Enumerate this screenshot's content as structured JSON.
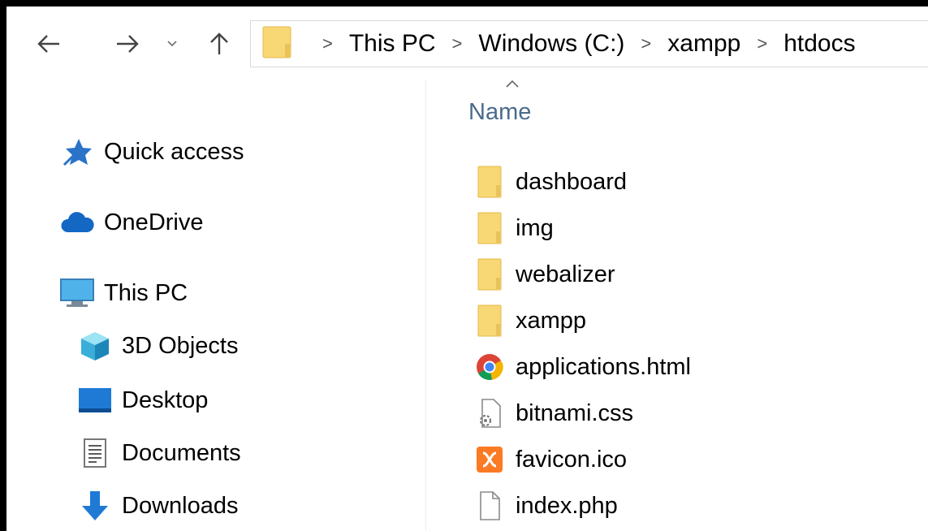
{
  "address_bar": {
    "breadcrumbs": [
      "This PC",
      "Windows (C:)",
      "xampp",
      "htdocs"
    ],
    "separator": ">"
  },
  "nav_pane": {
    "items": [
      {
        "label": "Quick access",
        "icon": "star-pin-icon"
      },
      {
        "label": "OneDrive",
        "icon": "cloud-icon"
      },
      {
        "label": "This PC",
        "icon": "monitor-icon"
      },
      {
        "label": "3D Objects",
        "icon": "cube-icon"
      },
      {
        "label": "Desktop",
        "icon": "desktop-icon"
      },
      {
        "label": "Documents",
        "icon": "document-icon"
      },
      {
        "label": "Downloads",
        "icon": "download-arrow-icon"
      }
    ]
  },
  "file_list": {
    "column_header": "Name",
    "files": [
      {
        "name": "dashboard",
        "icon": "folder-icon"
      },
      {
        "name": "img",
        "icon": "folder-icon"
      },
      {
        "name": "webalizer",
        "icon": "folder-icon"
      },
      {
        "name": "xampp",
        "icon": "folder-icon"
      },
      {
        "name": "applications.html",
        "icon": "chrome-icon"
      },
      {
        "name": "bitnami.css",
        "icon": "settings-file-icon"
      },
      {
        "name": "favicon.ico",
        "icon": "xampp-logo-icon"
      },
      {
        "name": "index.php",
        "icon": "blank-file-icon"
      }
    ]
  },
  "colors": {
    "folder": "#f8d775",
    "header_text": "#4a6a8e",
    "accent_blue": "#1e78d7",
    "xampp_orange": "#fb7a24"
  }
}
